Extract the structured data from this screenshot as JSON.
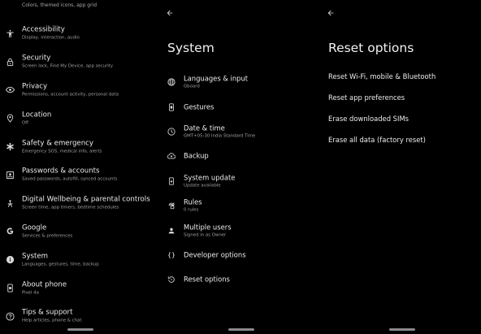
{
  "left_panel": {
    "top_partial_subtitle": "Colors, themed icons, app grid",
    "items": [
      {
        "title": "Accessibility",
        "subtitle": "Display, interaction, audio",
        "icon": "accessibility-icon"
      },
      {
        "title": "Security",
        "subtitle": "Screen lock, Find My Device, app security",
        "icon": "lock-icon"
      },
      {
        "title": "Privacy",
        "subtitle": "Permissions, account activity, personal data",
        "icon": "eye-icon"
      },
      {
        "title": "Location",
        "subtitle": "Off",
        "icon": "location-pin-icon"
      },
      {
        "title": "Safety & emergency",
        "subtitle": "Emergency SOS, medical info, alerts",
        "icon": "asterisk-icon"
      },
      {
        "title": "Passwords & accounts",
        "subtitle": "Saved passwords, autofill, synced accounts",
        "icon": "account-box-icon"
      },
      {
        "title": "Digital Wellbeing & parental controls",
        "subtitle": "Screen time, app timers, bedtime schedules",
        "icon": "wellbeing-icon"
      },
      {
        "title": "Google",
        "subtitle": "Services & preferences",
        "icon": "google-icon"
      },
      {
        "title": "System",
        "subtitle": "Languages, gestures, time, backup",
        "icon": "info-icon"
      },
      {
        "title": "About phone",
        "subtitle": "Pixel 4a",
        "icon": "phone-icon"
      },
      {
        "title": "Tips & support",
        "subtitle": "Help articles, phone & chat",
        "icon": "help-icon"
      }
    ]
  },
  "middle_panel": {
    "title": "System",
    "items": [
      {
        "title": "Languages & input",
        "subtitle": "Gboard",
        "icon": "globe-icon"
      },
      {
        "title": "Gestures",
        "subtitle": "",
        "icon": "gesture-phone-icon"
      },
      {
        "title": "Date & time",
        "subtitle": "GMT+05:30 India Standard Time",
        "icon": "clock-icon"
      },
      {
        "title": "Backup",
        "subtitle": "",
        "icon": "cloud-backup-icon"
      },
      {
        "title": "System update",
        "subtitle": "Update available",
        "icon": "system-update-icon"
      },
      {
        "title": "Rules",
        "subtitle": "0 rules",
        "icon": "rules-icon"
      },
      {
        "title": "Multiple users",
        "subtitle": "Signed in as Owner",
        "icon": "users-icon"
      },
      {
        "title": "Developer options",
        "subtitle": "",
        "icon": "code-braces-icon"
      },
      {
        "title": "Reset options",
        "subtitle": "",
        "icon": "reset-icon"
      }
    ]
  },
  "right_panel": {
    "title": "Reset options",
    "items": [
      "Reset Wi-Fi, mobile & Bluetooth",
      "Reset app preferences",
      "Erase downloaded SIMs",
      "Erase all data (factory reset)"
    ]
  },
  "colors": {
    "background": "#000000",
    "text_primary": "#ececec",
    "text_secondary": "#a0a0a0"
  }
}
